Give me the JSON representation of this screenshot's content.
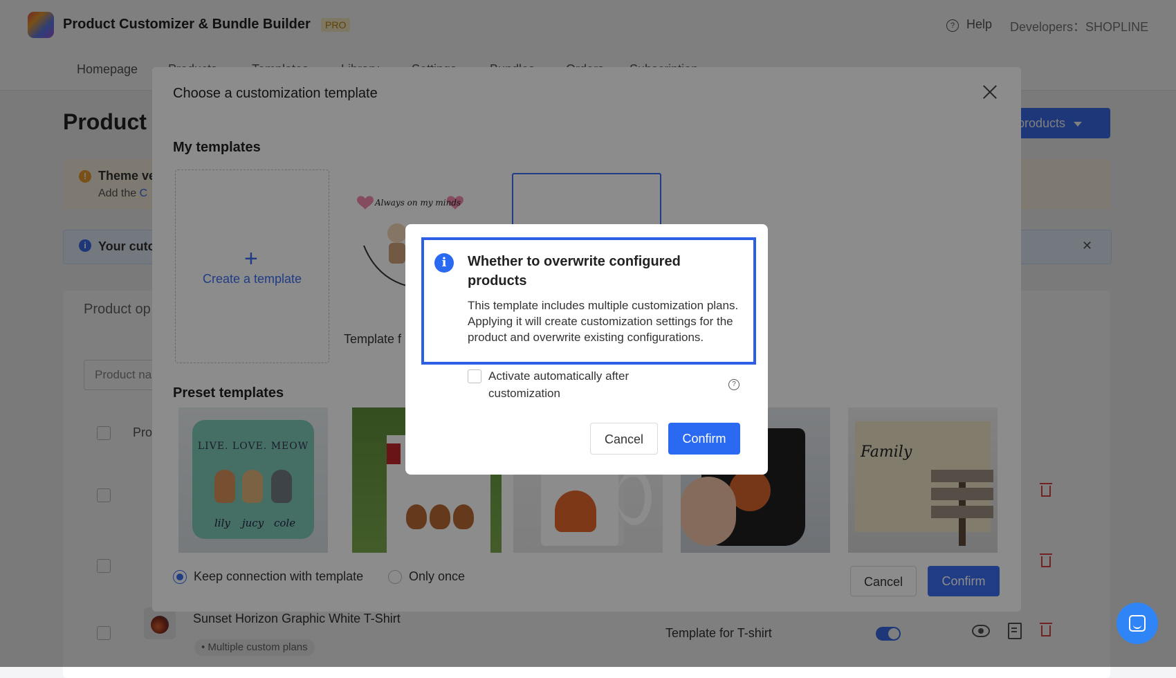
{
  "app": {
    "title": "Product Customizer & Bundle Builder",
    "badge": "PRO",
    "help_label": "Help",
    "developer_label": "Developers：SHOPLINE"
  },
  "nav": {
    "items": [
      "Homepage",
      "Products",
      "Templates",
      "Library",
      "Settings",
      "Bundles",
      "Orders",
      "Subscription"
    ]
  },
  "page": {
    "title": "Product l",
    "add_button": "products",
    "warning_title": "Theme ve",
    "warning_desc_prefix": "Add the ",
    "warning_desc_link": "C",
    "info_text": "Your cuto",
    "card_title": "Product op",
    "search_placeholder": "Product na",
    "table_header": "Pro",
    "product_name": "Sunset Horizon Graphic White T-Shirt",
    "product_tag": "• Multiple custom plans",
    "product_template": "Template for T-shirt"
  },
  "template_modal": {
    "title": "Choose a customization template",
    "my_templates_title": "My templates",
    "create_label": "Create a template",
    "my_template_label": "Template f",
    "my_template_art_text": "Always on my minds",
    "preset_templates_title": "Preset templates",
    "preset_1": {
      "text": "LIVE. LOVE. MEOW",
      "names": [
        "lily",
        "jucy",
        "cole"
      ]
    },
    "preset_5": {
      "text": "Family"
    },
    "option_keep": "Keep connection with template",
    "option_once": "Only once",
    "cancel_label": "Cancel",
    "confirm_label": "Confirm"
  },
  "confirm_dialog": {
    "title": "Whether to overwrite configured products",
    "body": "This template includes multiple customization plans. Applying it will create customization settings for the product and overwrite existing configurations.",
    "checkbox_label": "Activate automatically after customization",
    "cancel_label": "Cancel",
    "confirm_label": "Confirm"
  },
  "colors": {
    "primary": "#2a6af2",
    "highlight": "#2f5ee6",
    "danger": "#e54545"
  }
}
